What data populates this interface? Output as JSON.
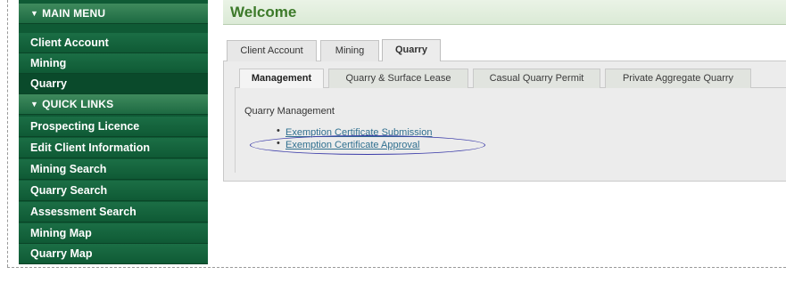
{
  "sidebar": {
    "main_menu_header": "MAIN MENU",
    "main_menu_items": [
      "Client Account",
      "Mining",
      "Quarry"
    ],
    "quick_links_header": "QUICK LINKS",
    "quick_links_items": [
      "Prospecting Licence",
      "Edit Client Information",
      "Mining Search",
      "Quarry Search",
      "Assessment Search",
      "Mining Map",
      "Quarry Map"
    ],
    "active_item": "Quarry",
    "header_icon": "triangle-down-icon"
  },
  "header": {
    "title": "Welcome"
  },
  "outer_tabs": [
    "Client Account",
    "Mining",
    "Quarry"
  ],
  "outer_tab_active": "Quarry",
  "inner_tabs": [
    "Management",
    "Quarry & Surface Lease",
    "Casual Quarry Permit",
    "Private Aggregate Quarry"
  ],
  "inner_tab_active": "Management",
  "management": {
    "section_label": "Quarry Management",
    "links": [
      "Exemption Certificate Submission",
      "Exemption Certificate Approval"
    ],
    "highlighted_link": "Exemption Certificate Approval"
  },
  "colors": {
    "sidebar_bg": "#0f5a35",
    "welcome_text": "#3d7a2a",
    "link": "#2f6f8f",
    "highlight_oval": "#3a3aa8"
  }
}
